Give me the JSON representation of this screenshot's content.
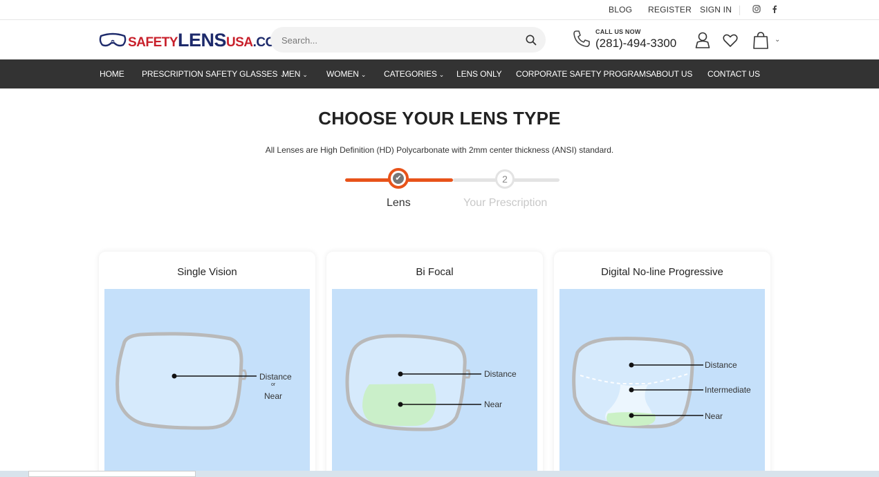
{
  "topbar": {
    "blog": "BLOG",
    "register": "REGISTER",
    "signin": "SIGN IN",
    "instagram_icon": "instagram-icon",
    "facebook_icon": "facebook-icon"
  },
  "header": {
    "logo": {
      "part1": "SAFETY",
      "part2": "LENS",
      "part3": "USA",
      "part4": ".COM"
    },
    "search_placeholder": "Search...",
    "call_label": "CALL US NOW",
    "call_number": "(281)-494-3300"
  },
  "nav": {
    "items": [
      {
        "label": "HOME",
        "dropdown": false
      },
      {
        "label": "PRESCRIPTION SAFETY GLASSES",
        "dropdown": true
      },
      {
        "label": "MEN",
        "dropdown": true
      },
      {
        "label": "WOMEN",
        "dropdown": true
      },
      {
        "label": "CATEGORIES",
        "dropdown": true
      },
      {
        "label": "LENS ONLY",
        "dropdown": false
      },
      {
        "label": "CORPORATE SAFETY PROGRAMS",
        "dropdown": false
      },
      {
        "label": "ABOUT US",
        "dropdown": false
      },
      {
        "label": "CONTACT US",
        "dropdown": false
      }
    ],
    "caret": "⌄"
  },
  "main": {
    "title": "CHOOSE YOUR LENS TYPE",
    "subtitle": "All Lenses are High Definition (HD) Polycarbonate with 2mm center thickness (ANSI) standard."
  },
  "stepper": {
    "step1_label": "Lens",
    "step1_check": "✔",
    "step2_number": "2",
    "step2_label": "Your Prescription",
    "progress": 0.5
  },
  "cards": [
    {
      "title": "Single Vision",
      "labels": {
        "distance": "Distance",
        "or": "or",
        "near": "Near"
      }
    },
    {
      "title": "Bi Focal",
      "labels": {
        "distance": "Distance",
        "near": "Near"
      }
    },
    {
      "title": "Digital No-line Progressive",
      "labels": {
        "distance": "Distance",
        "intermediate": "Intermediate",
        "near": "Near"
      }
    }
  ],
  "colors": {
    "accent": "#e8531a",
    "nav_bg": "#333333",
    "lens_bg": "#c5e0fa",
    "near_zone": "#c9f0c3",
    "logo_red": "#c8202b",
    "logo_navy": "#1d2a6b"
  }
}
